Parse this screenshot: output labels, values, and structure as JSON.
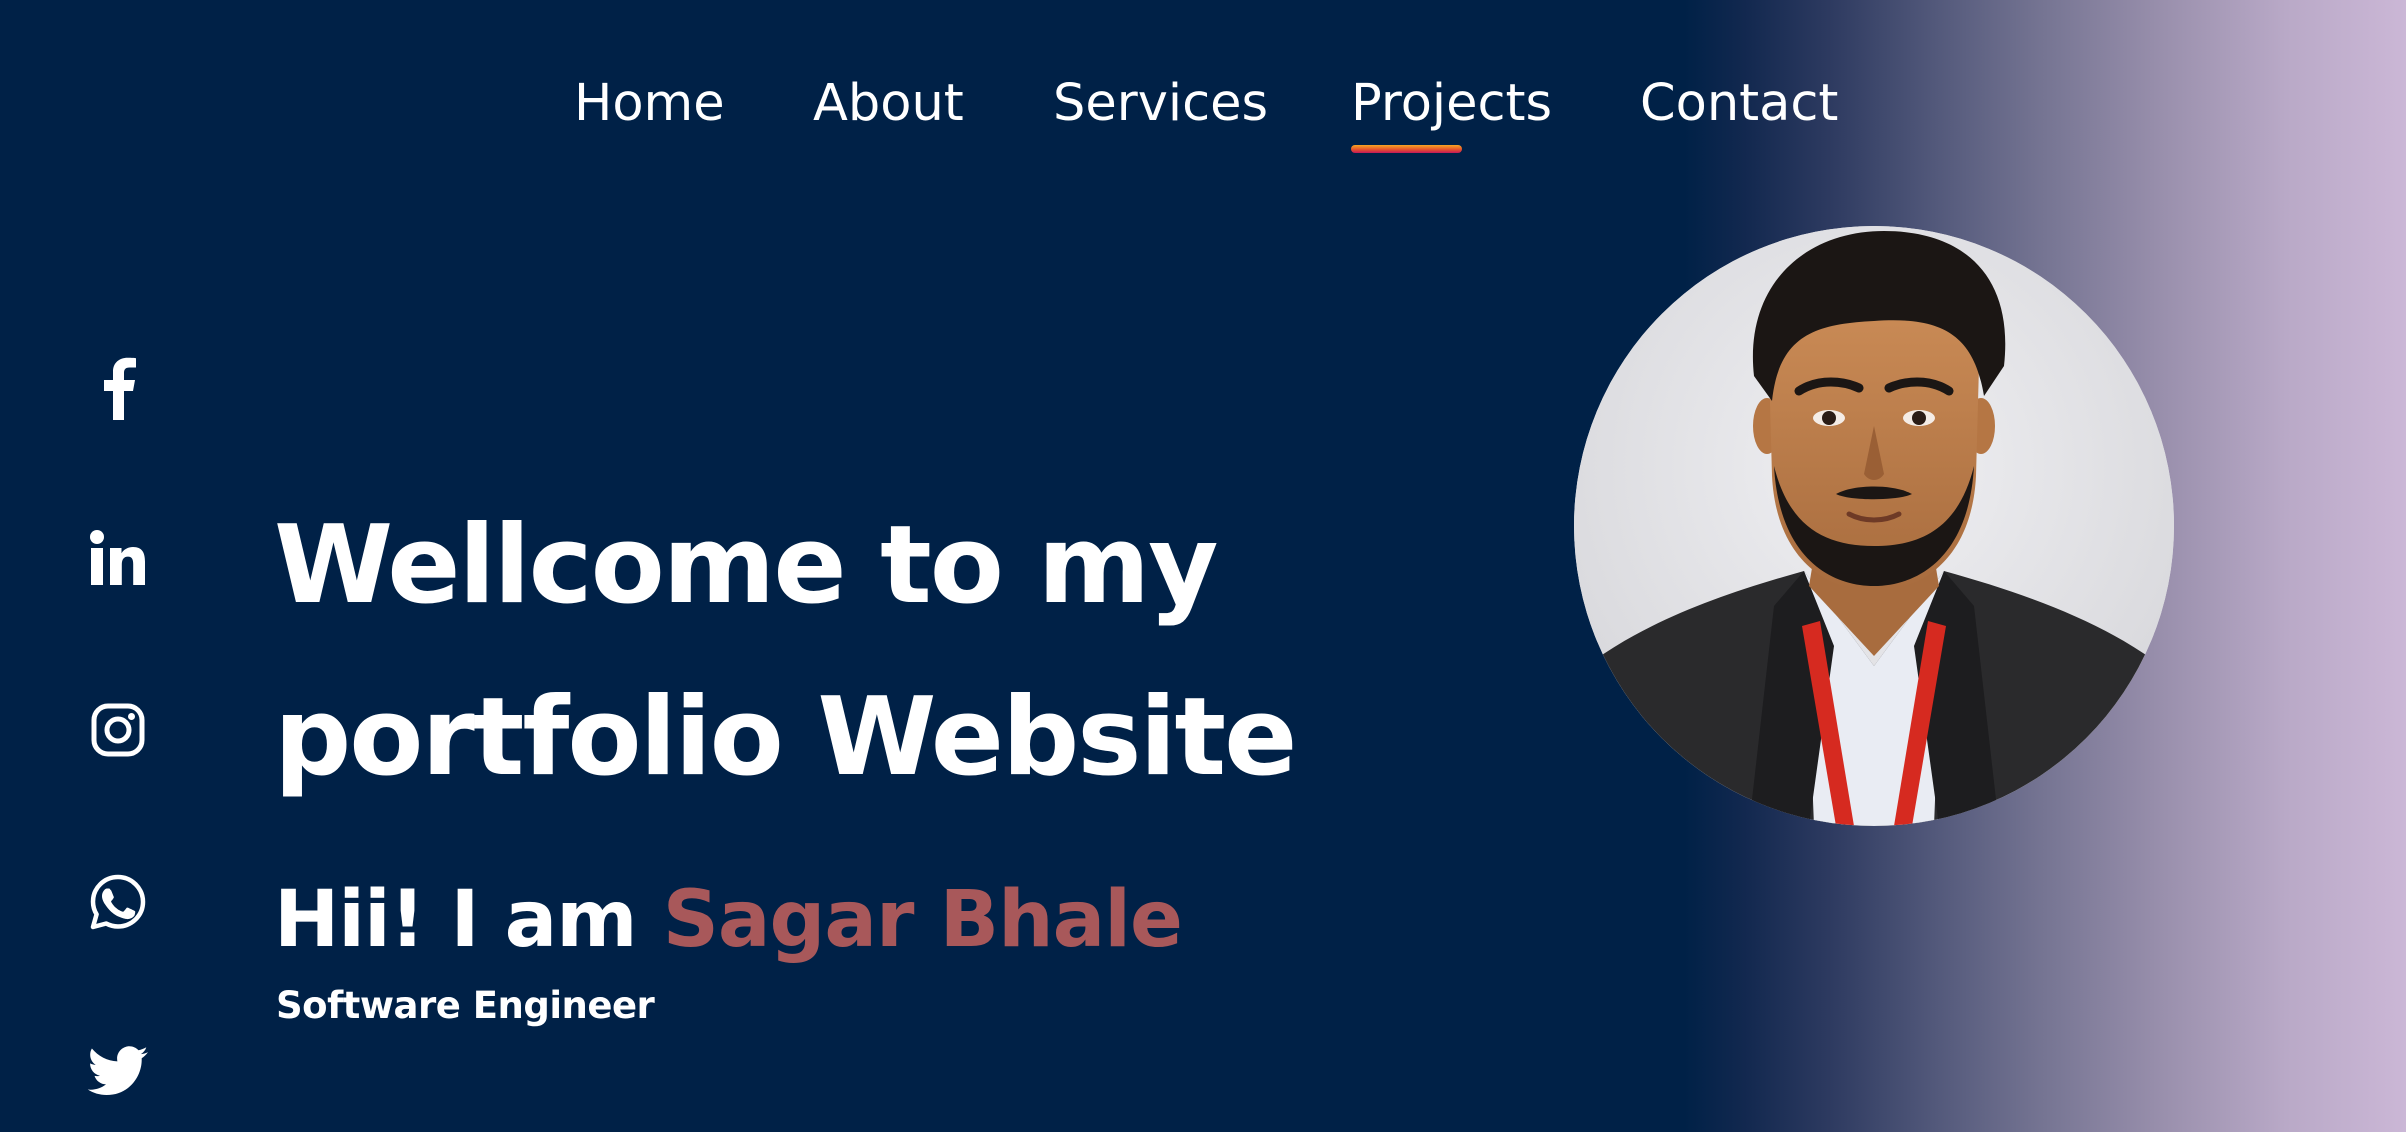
{
  "nav": {
    "items": [
      {
        "label": "Home"
      },
      {
        "label": "About"
      },
      {
        "label": "Services"
      },
      {
        "label": "Projects"
      },
      {
        "label": "Contact"
      }
    ],
    "active": "Projects"
  },
  "social": [
    {
      "icon": "facebook-icon"
    },
    {
      "icon": "linkedin-icon"
    },
    {
      "icon": "instagram-icon"
    },
    {
      "icon": "whatsapp-icon"
    },
    {
      "icon": "twitter-icon"
    }
  ],
  "hero": {
    "headline_line1": "Wellcome to my",
    "headline_line2": "portfolio Website",
    "greeting_prefix": "Hii! I am ",
    "name": "Sagar Bhale",
    "role": "Software Engineer"
  },
  "colors": {
    "background": "#002147",
    "accent_name": "#a8585a",
    "gradient_end": "#cbb7d6",
    "underline": "#e8552a"
  }
}
